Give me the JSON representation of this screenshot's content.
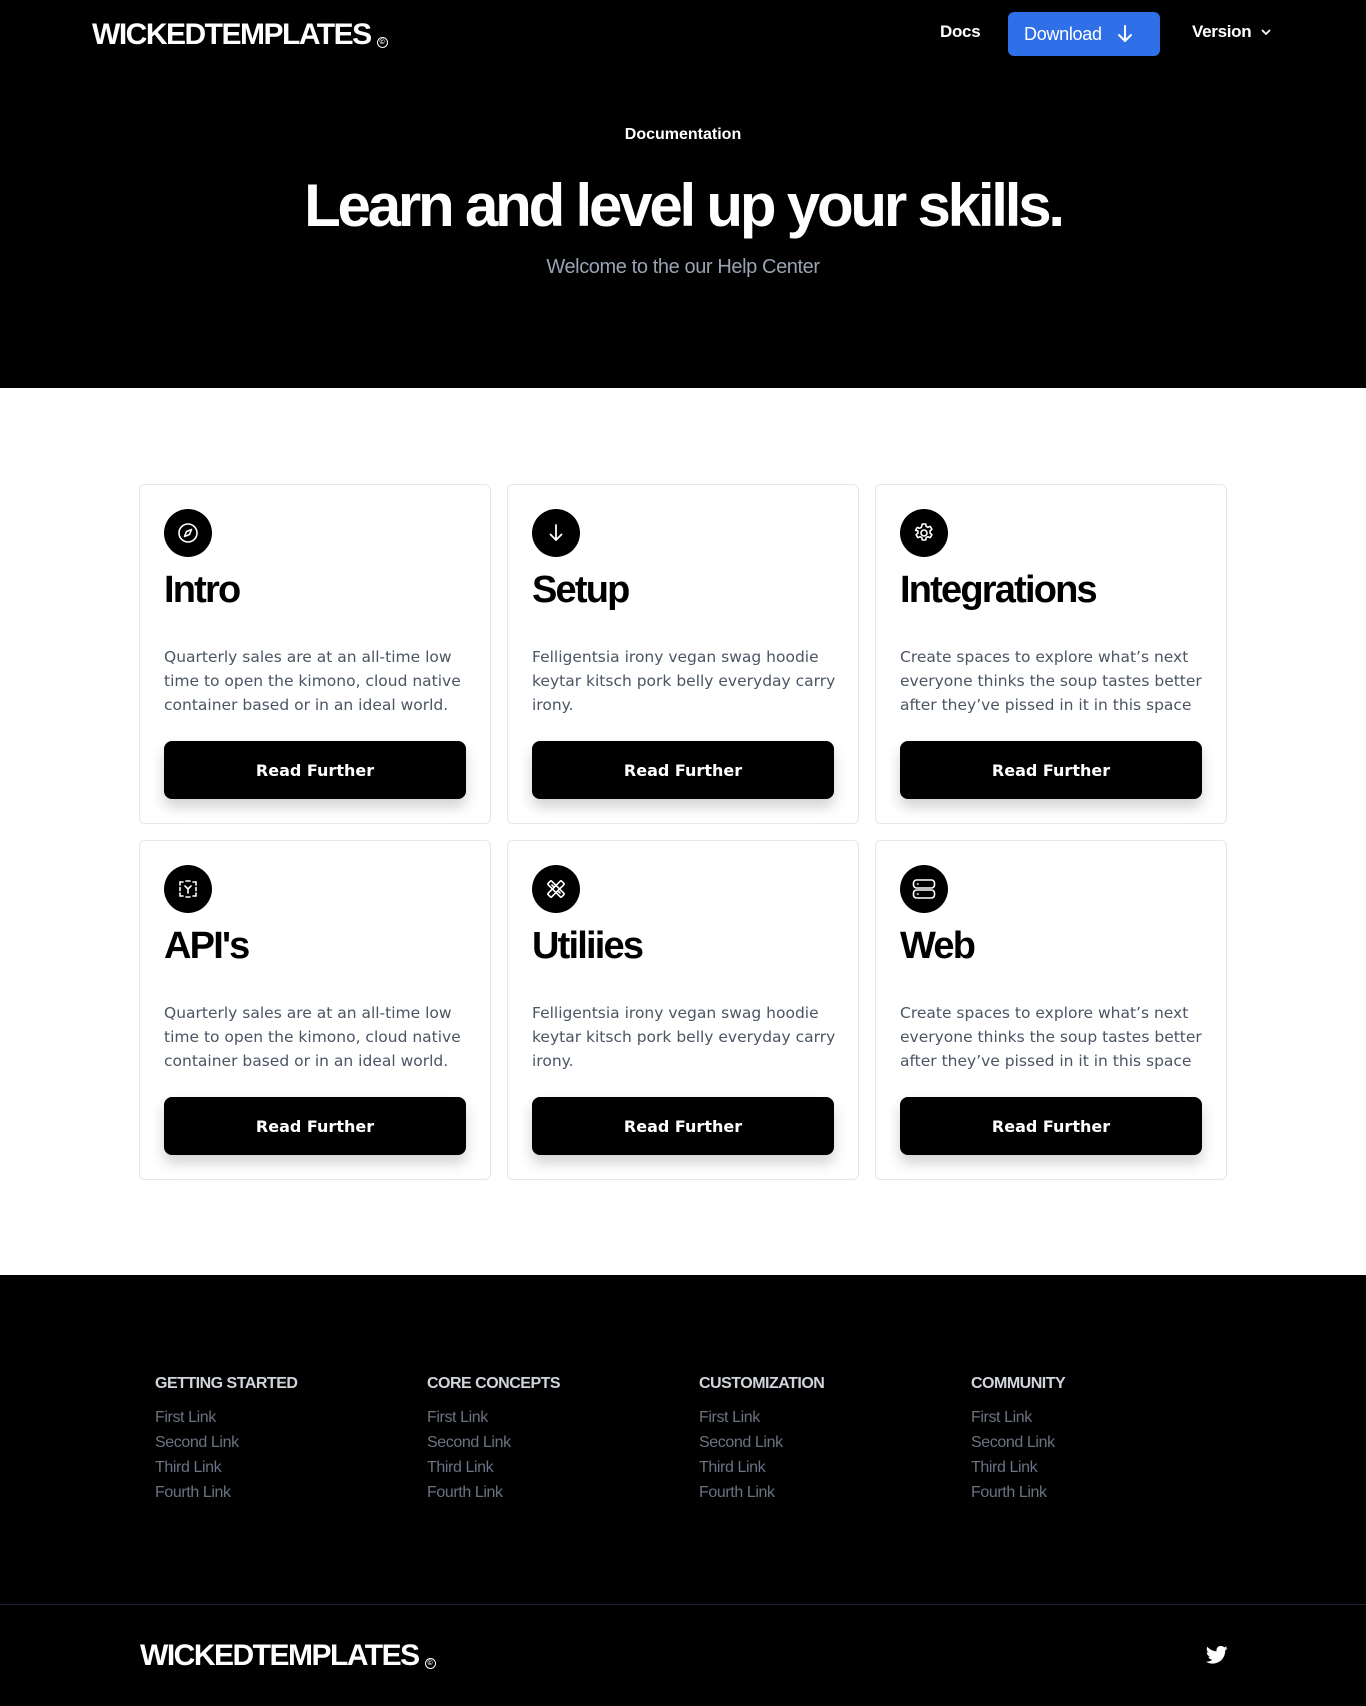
{
  "header": {
    "logo": "WICKEDTEMPLATES",
    "logo_mark": "©",
    "nav_docs": "Docs",
    "download_label": "Download",
    "version_label": "Version"
  },
  "hero": {
    "eyebrow": "Documentation",
    "title": "Learn and level up your skills.",
    "subtitle": "Welcome to the our Help Center"
  },
  "cards": [
    {
      "icon": "compass-icon",
      "title": "Intro",
      "desc": "Quarterly sales are at an all-time low time to open the kimono, cloud native container based or in an ideal world.",
      "button": "Read Further"
    },
    {
      "icon": "arrow-down-icon",
      "title": "Setup",
      "desc": "Felligentsia irony vegan swag hoodie keytar kitsch pork belly everyday carry irony.",
      "button": "Read Further"
    },
    {
      "icon": "gear-icon",
      "title": "Integrations",
      "desc": "Create spaces to explore what’s next everyone thinks the soup tastes better after they’ve pissed in it in this space",
      "button": "Read Further"
    },
    {
      "icon": "api-icon",
      "title": "API's",
      "desc": "Quarterly sales are at an all-time low time to open the kimono, cloud native container based or in an ideal world.",
      "button": "Read Further"
    },
    {
      "icon": "tools-icon",
      "title": "Utiliies",
      "desc": "Felligentsia irony vegan swag hoodie keytar kitsch pork belly everyday carry irony.",
      "button": "Read Further"
    },
    {
      "icon": "server-icon",
      "title": "Web",
      "desc": "Create spaces to explore what’s next everyone thinks the soup tastes better after they’ve pissed in it in this space",
      "button": "Read Further"
    }
  ],
  "footer": {
    "columns": [
      {
        "heading": "GETTING STARTED",
        "links": [
          "First Link",
          "Second Link",
          "Third Link",
          "Fourth Link"
        ]
      },
      {
        "heading": "CORE CONCEPTS",
        "links": [
          "First Link",
          "Second Link",
          "Third Link",
          "Fourth Link"
        ]
      },
      {
        "heading": "CUSTOMIZATION",
        "links": [
          "First Link",
          "Second Link",
          "Third Link",
          "Fourth Link"
        ]
      },
      {
        "heading": "COMMUNITY",
        "links": [
          "First Link",
          "Second Link",
          "Third Link",
          "Fourth Link"
        ]
      }
    ],
    "logo": "WICKEDTEMPLATES",
    "logo_mark": "©",
    "social_icon": "twitter-icon"
  },
  "colors": {
    "accent": "#2f6fe8",
    "background_dark": "#000000",
    "text_muted": "#6b7280"
  }
}
